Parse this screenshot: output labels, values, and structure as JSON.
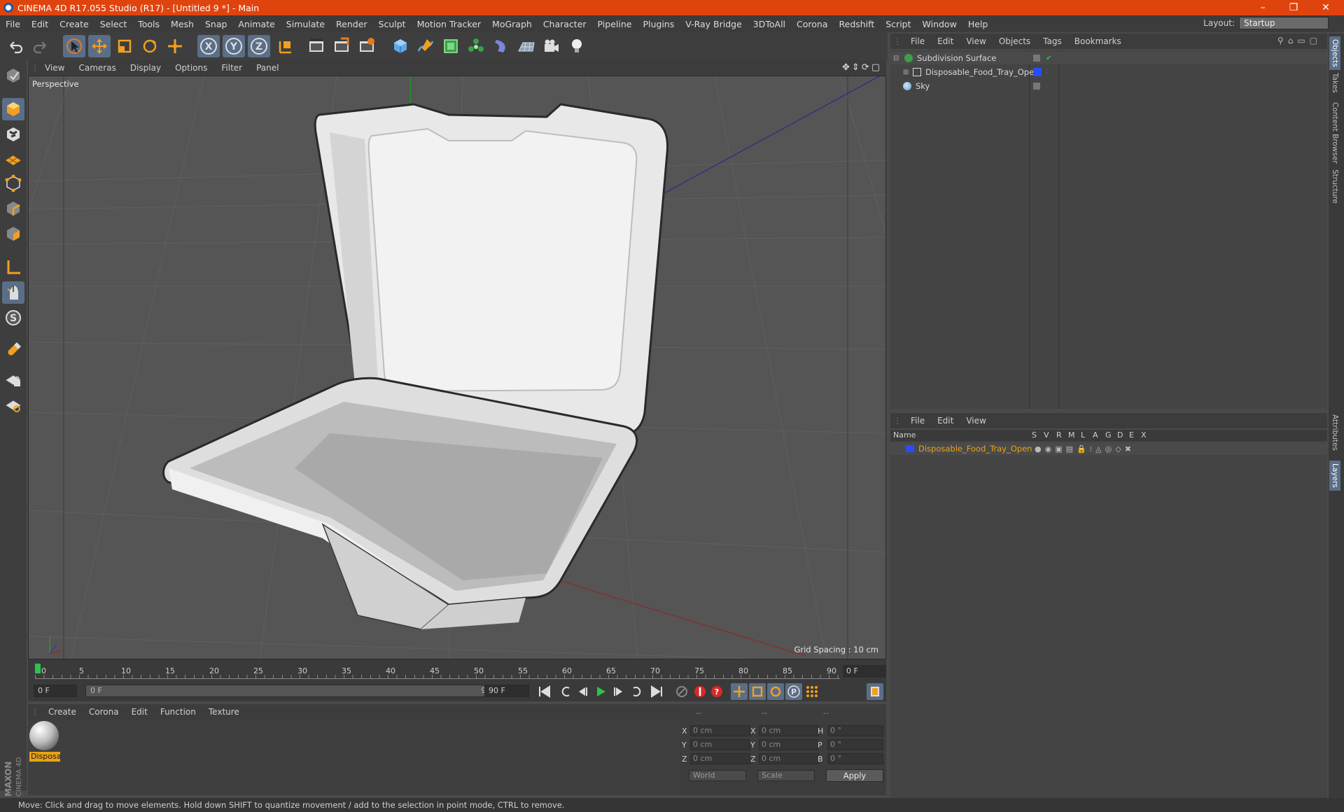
{
  "window": {
    "title": "CINEMA 4D R17.055 Studio (R17) - [Untitled 9 *] - Main",
    "controls": [
      "–",
      "❐",
      "✕"
    ]
  },
  "menu": [
    "File",
    "Edit",
    "Create",
    "Select",
    "Tools",
    "Mesh",
    "Snap",
    "Animate",
    "Simulate",
    "Render",
    "Sculpt",
    "Motion Tracker",
    "MoGraph",
    "Character",
    "Pipeline",
    "Plugins",
    "V-Ray Bridge",
    "3DToAll",
    "Corona",
    "Redshift",
    "Script",
    "Window",
    "Help"
  ],
  "layout": {
    "label": "Layout:",
    "value": "Startup"
  },
  "toolbar": {
    "axis_x": "X",
    "axis_y": "Y",
    "axis_z": "Z"
  },
  "viewport": {
    "menu": [
      "View",
      "Cameras",
      "Display",
      "Options",
      "Filter",
      "Panel"
    ],
    "label": "Perspective",
    "grid_spacing": "Grid Spacing : 10 cm"
  },
  "timeline": {
    "ticks": [
      "0",
      "5",
      "10",
      "15",
      "20",
      "25",
      "30",
      "35",
      "40",
      "45",
      "50",
      "55",
      "60",
      "65",
      "70",
      "75",
      "80",
      "85",
      "90"
    ],
    "current_frame": "0 F"
  },
  "transport": {
    "start": "0 F",
    "range_start": "0 F",
    "range_end": "90 F",
    "end": "90 F"
  },
  "material_manager": {
    "menu": [
      "Create",
      "Corona",
      "Edit",
      "Function",
      "Texture"
    ],
    "material_name": "Disposa"
  },
  "coordinates": {
    "header": [
      "--",
      "--",
      "--"
    ],
    "rows": [
      {
        "l1": "X",
        "v1": "0 cm",
        "l2": "X",
        "v2": "0 cm",
        "l3": "H",
        "v3": "0 °"
      },
      {
        "l1": "Y",
        "v1": "0 cm",
        "l2": "Y",
        "v2": "0 cm",
        "l3": "P",
        "v3": "0 °"
      },
      {
        "l1": "Z",
        "v1": "0 cm",
        "l2": "Z",
        "v2": "0 cm",
        "l3": "B",
        "v3": "0 °"
      }
    ],
    "world": "World",
    "scale": "Scale",
    "apply": "Apply"
  },
  "object_manager": {
    "menu": [
      "File",
      "Edit",
      "View",
      "Objects",
      "Tags",
      "Bookmarks"
    ],
    "objects": [
      {
        "name": "Subdivision Surface"
      },
      {
        "name": "Disposable_Food_Tray_Open"
      },
      {
        "name": "Sky"
      }
    ]
  },
  "layer_manager": {
    "menu": [
      "File",
      "Edit",
      "View"
    ],
    "columns": [
      "Name",
      "S",
      "V",
      "R",
      "M",
      "L",
      "A",
      "G",
      "D",
      "E",
      "X"
    ],
    "layer_name": "Disposable_Food_Tray_Open",
    "layer_color": "#2a4cff"
  },
  "right_tabs": [
    "Objects",
    "Takes",
    "Content Browser",
    "Structure",
    "Attributes",
    "Layers"
  ],
  "status": "Move: Click and drag to move elements. Hold down SHIFT to quantize movement / add to the selection in point mode, CTRL to remove.",
  "brand": "MAXON CINEMA 4D",
  "colors": {
    "title_bar": "#e0440e",
    "accent": "#5a6e87",
    "highlight": "#e8a317"
  }
}
